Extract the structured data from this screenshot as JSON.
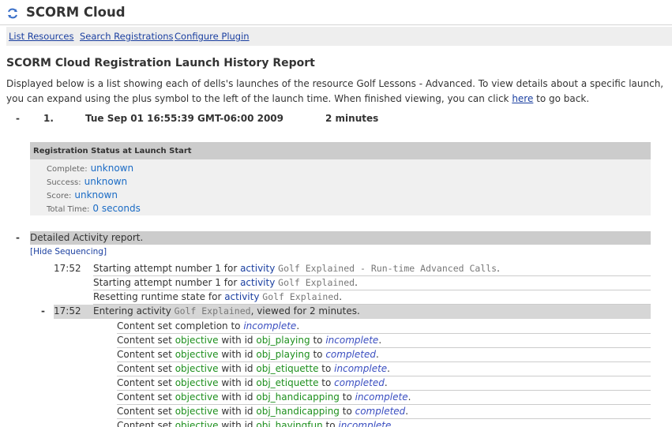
{
  "app": {
    "title": "SCORM Cloud",
    "accent": "#1a3fa0"
  },
  "nav": {
    "items": [
      "List Resources",
      "Search Registrations",
      "Configure Plugin"
    ]
  },
  "report": {
    "title": "SCORM Cloud Registration Launch History Report",
    "intro_before_link": "Displayed below is a list showing each of dells's launches of the resource Golf Lessons - Advanced. To view details about a specific launch, you can expand using the plus symbol to the left of the launch time. When finished viewing, you can click ",
    "intro_link": "here",
    "intro_after_link": " to go back."
  },
  "launch": {
    "toggle": "-",
    "number": "1.",
    "time": "Tue Sep 01 16:55:39 GMT-06:00 2009",
    "duration": "2 minutes"
  },
  "status": {
    "heading": "Registration Status at Launch Start",
    "rows": [
      {
        "label": "Complete:",
        "value": "unknown"
      },
      {
        "label": "Success:",
        "value": "unknown"
      },
      {
        "label": "Score:",
        "value": "unknown"
      },
      {
        "label": "Total Time:",
        "value": "0 seconds"
      }
    ]
  },
  "detail": {
    "toggle": "-",
    "title": "Detailed Activity report.",
    "hide_link": "[Hide Sequencing]"
  },
  "log": [
    {
      "time": "17:52",
      "text": "Starting attempt number 1 for ",
      "kw": "activity",
      "name": "Golf Explained - Run-time Advanced Calls",
      "end": "."
    },
    {
      "time": "",
      "text": "Starting attempt number 1 for ",
      "kw": "activity",
      "name": "Golf Explained",
      "end": "."
    },
    {
      "time": "",
      "text": "Resetting runtime state for ",
      "kw": "activity",
      "name": "Golf Explained",
      "end": "."
    },
    {
      "time": "17:52",
      "toggle": "-",
      "text": "Entering activity ",
      "kw": "",
      "name": "Golf Explained",
      "end": ", viewed for 2 minutes."
    }
  ],
  "content": {
    "prefix": "Content set ",
    "completion_label": "completion to ",
    "objective_kw": "objective",
    "with_id": " with id ",
    "to": " to ",
    "items": [
      {
        "type": "completion",
        "status": "incomplete"
      },
      {
        "type": "objective",
        "id": "obj_playing",
        "status": "incomplete"
      },
      {
        "type": "objective",
        "id": "obj_playing",
        "status": "completed"
      },
      {
        "type": "objective",
        "id": "obj_etiquette",
        "status": "incomplete"
      },
      {
        "type": "objective",
        "id": "obj_etiquette",
        "status": "completed"
      },
      {
        "type": "objective",
        "id": "obj_handicapping",
        "status": "incomplete"
      },
      {
        "type": "objective",
        "id": "obj_handicapping",
        "status": "completed"
      },
      {
        "type": "objective",
        "id": "obj_havingfun",
        "status": "incomplete"
      }
    ]
  }
}
